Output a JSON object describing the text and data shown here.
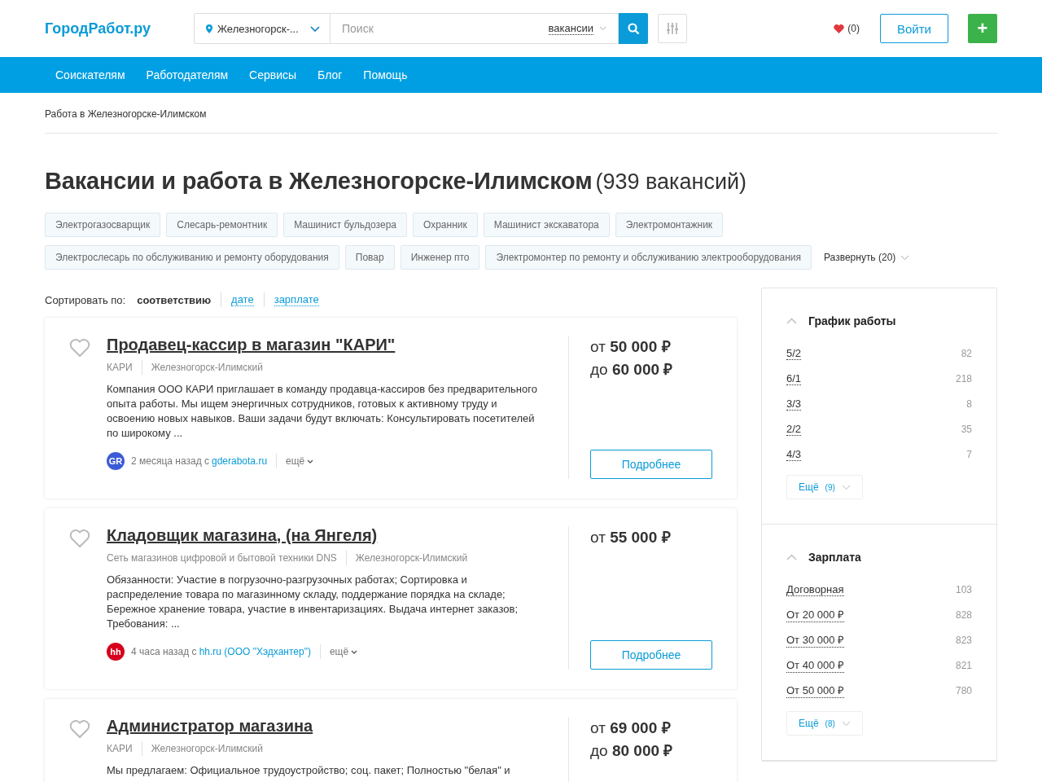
{
  "header": {
    "logo": "ГородРабот.ру",
    "city": "Железногорск-...",
    "search_placeholder": "Поиск",
    "search_scope": "вакансии",
    "favorites": "(0)",
    "login": "Войти",
    "add": "+"
  },
  "nav": [
    "Соискателям",
    "Работодателям",
    "Сервисы",
    "Блог",
    "Помощь"
  ],
  "breadcrumb": "Работа в Железногорске-Илимском",
  "title": "Вакансии и работа в Железногорске-Илимском",
  "title_count": "(939 вакансий)",
  "tags": [
    [
      "Электрогазосварщик",
      "Слесарь-ремонтник",
      "Машинист бульдозера",
      "Охранник",
      "Машинист экскаватора",
      "Электромонтажник"
    ],
    [
      "Электрослесарь по обслуживанию и ремонту оборудования",
      "Повар",
      "Инженер пто",
      "Электромонтер по ремонту и обслуживанию электрооборудования"
    ]
  ],
  "expand_tags": "Развернуть (20)",
  "sort": {
    "label": "Сортировать по:",
    "options": [
      {
        "label": "соответствию",
        "selected": true
      },
      {
        "label": "дате",
        "selected": false
      },
      {
        "label": "зарплате",
        "selected": false
      }
    ]
  },
  "vacancies": [
    {
      "title": "Продавец-кассир в магазин \"КАРИ\"",
      "company": "КАРИ",
      "city": "Железногорск-Илимский",
      "description": "Компания ООО КАРИ приглашает в команду продавца-кассиров без предварительного опыта работы. Мы ищем энергичных сотрудников, готовых к активному труду и освоению новых навыков. Ваши задачи будут включать: Консультировать посетителей по широкому ...",
      "source_logo": "GR",
      "color": "#3b5bd6",
      "posted": "2 месяца назад с",
      "source": "gderabota.ru",
      "more": "ещё",
      "salary": [
        {
          "prefix": "от",
          "amount": "50 000",
          "currency": "₽"
        },
        {
          "prefix": "до",
          "amount": "60 000",
          "currency": "₽"
        }
      ],
      "button": "Подробнее"
    },
    {
      "title": "Кладовщик магазина, (на Янгеля)",
      "company": "Сеть магазинов цифровой и бытовой техники DNS",
      "city": "Железногорск-Илимский",
      "description": "Обязанности: Участие в погрузочно-разгрузочных работах; Сортировка и распределение товара по магазинному складу, поддержание порядка на складе; Бережное хранение товара, участие в инвентаризациях. Выдача интернет заказов; Требования: ...",
      "source_logo": "hh",
      "color": "#d6001c",
      "posted": "4 часа назад с",
      "source": "hh.ru (ООО \"Хэдхантер\")",
      "more": "ещё",
      "salary": [
        {
          "prefix": "от",
          "amount": "55 000",
          "currency": "₽"
        }
      ],
      "button": "Подробнее"
    },
    {
      "title": "Администратор магазина",
      "company": "КАРИ",
      "city": "Железногорск-Илимский",
      "description": "Мы предлагаем: Официальное трудоустройство; соц. пакет; Полностью \"белая\" и",
      "salary": [
        {
          "prefix": "от",
          "amount": "69 000",
          "currency": "₽"
        },
        {
          "prefix": "до",
          "amount": "80 000",
          "currency": "₽"
        }
      ]
    }
  ],
  "filters": [
    {
      "title": "График работы",
      "expanded": true,
      "items": [
        {
          "label": "5/2",
          "count": "82"
        },
        {
          "label": "6/1",
          "count": "218"
        },
        {
          "label": "3/3",
          "count": "8"
        },
        {
          "label": "2/2",
          "count": "35"
        },
        {
          "label": "4/3",
          "count": "7"
        }
      ],
      "more": "Ещё",
      "more_count": "(9)"
    },
    {
      "title": "Зарплата",
      "expanded": true,
      "items": [
        {
          "label": "Договорная",
          "count": "103"
        },
        {
          "label": "От 20 000 ₽",
          "count": "828"
        },
        {
          "label": "От 30 000 ₽",
          "count": "823"
        },
        {
          "label": "От 40 000 ₽",
          "count": "821"
        },
        {
          "label": "От 50 000 ₽",
          "count": "780"
        }
      ],
      "more": "Ещё",
      "more_count": "(8)"
    }
  ]
}
